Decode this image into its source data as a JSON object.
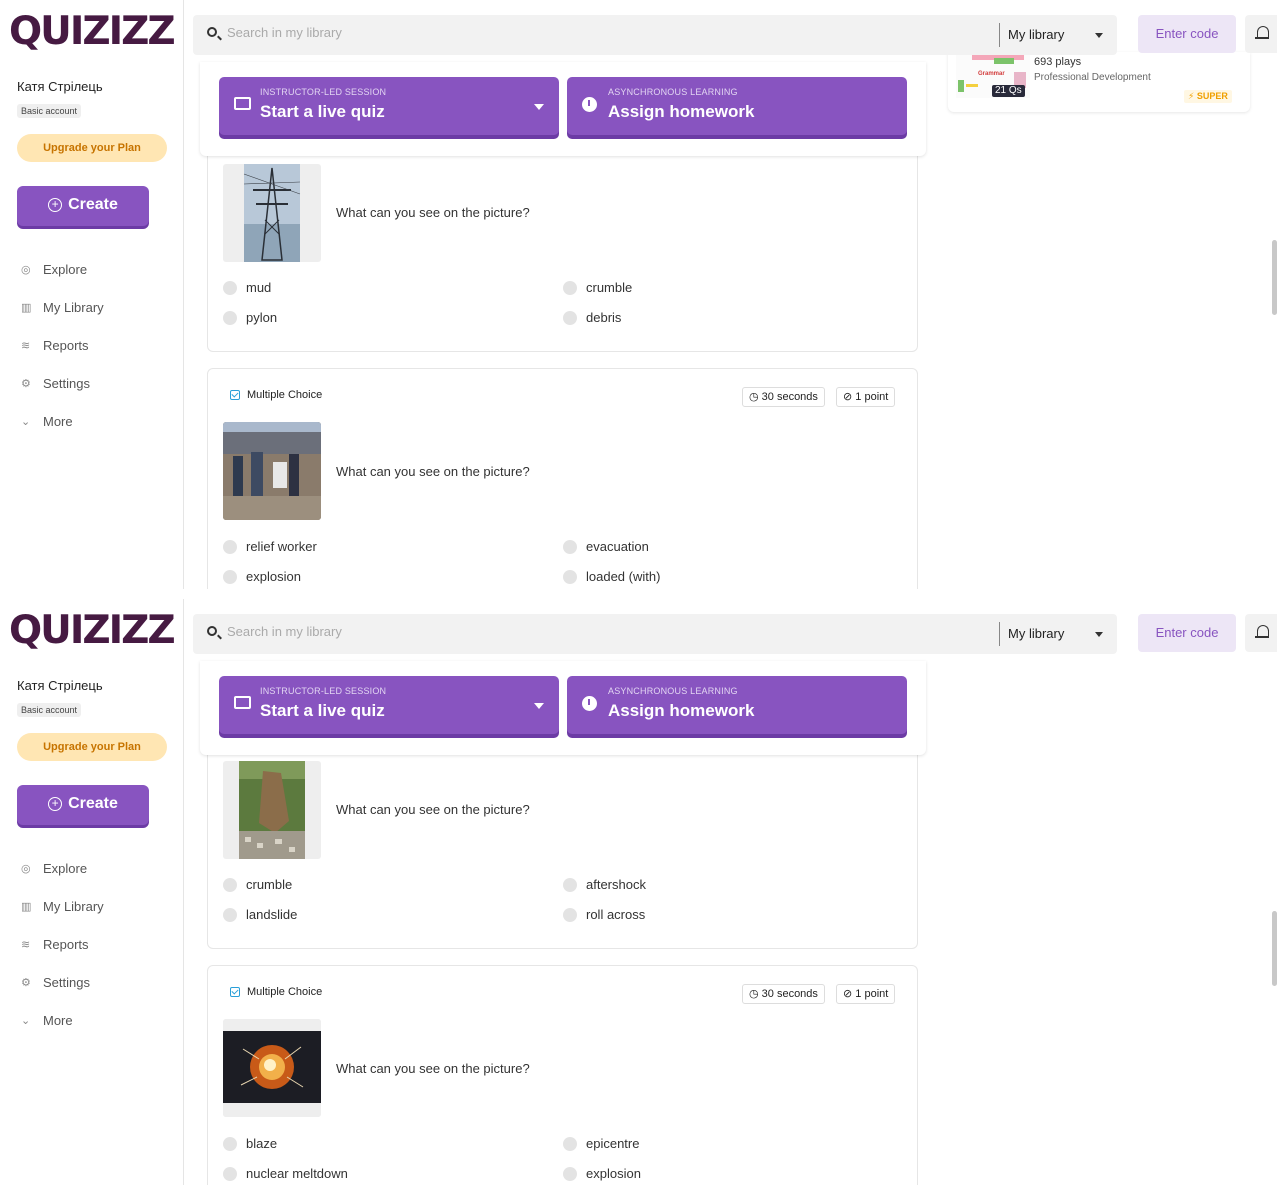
{
  "app": {
    "logo": "QUIZIZZ",
    "user_name": "Катя Стрілець",
    "account_type": "Basic account",
    "upgrade_label": "Upgrade your Plan",
    "create_label": "Create",
    "nav": [
      "Explore",
      "My Library",
      "Reports",
      "Settings",
      "More"
    ],
    "search_placeholder": "Search in my library",
    "scope_label": "My library",
    "enter_code_label": "Enter code",
    "accent_color": "#8854c0"
  },
  "actions": {
    "live": {
      "sub": "INSTRUCTOR-LED SESSION",
      "label": "Start a live quiz"
    },
    "homework": {
      "sub": "ASYNCHRONOUS LEARNING",
      "label": "Assign homework"
    }
  },
  "side_quiz": {
    "plays": "693 plays",
    "category": "Professional Development",
    "qs": "21 Qs",
    "badge": "SUPER",
    "thumb_text": "Grammar"
  },
  "screens": [
    {
      "questions": [
        {
          "text": "What can you see on the picture?",
          "image": "pylon-photo",
          "options": [
            "mud",
            "crumble",
            "pylon",
            "debris"
          ]
        },
        {
          "type": "Multiple Choice",
          "time": "30 seconds",
          "points": "1 point",
          "text": "What can you see on the picture?",
          "image": "relief-workers-photo",
          "options": [
            "relief worker",
            "evacuation",
            "explosion",
            "loaded (with)"
          ]
        }
      ]
    },
    {
      "questions": [
        {
          "text": "What can you see on the picture?",
          "image": "landslide-photo",
          "options": [
            "crumble",
            "aftershock",
            "landslide",
            "roll across"
          ]
        },
        {
          "type": "Multiple Choice",
          "time": "30 seconds",
          "points": "1 point",
          "text": "What can you see on the picture?",
          "image": "explosion-photo",
          "options": [
            "blaze",
            "epicentre",
            "nuclear meltdown",
            "explosion"
          ]
        }
      ]
    }
  ]
}
